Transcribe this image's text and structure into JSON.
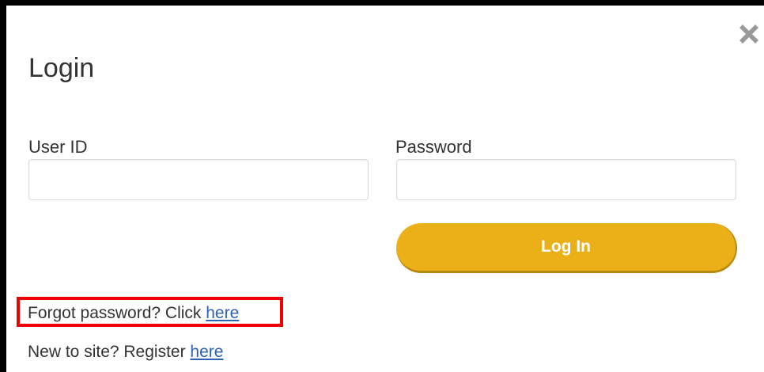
{
  "dialog": {
    "title": "Login",
    "close_icon": "close-x-icon",
    "colors": {
      "button_bg": "#ebb017",
      "link": "#2c63b6",
      "highlight_border": "#ee0000"
    }
  },
  "form": {
    "user_id_label": "User ID",
    "user_id_value": "",
    "password_label": "Password",
    "password_value": "",
    "login_button_label": "Log In"
  },
  "links": {
    "forgot_prefix": "Forgot password? Click ",
    "forgot_link": "here",
    "register_prefix": "New to site? Register ",
    "register_link": "here"
  }
}
